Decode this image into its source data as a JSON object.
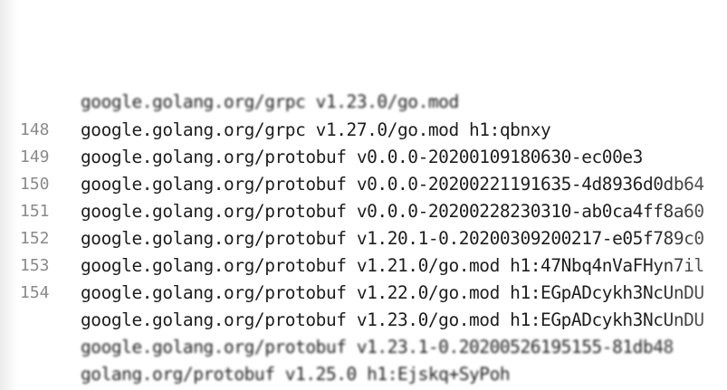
{
  "editor": {
    "lines": [
      {
        "number": "",
        "text": "",
        "blur": "heavy"
      },
      {
        "number": "",
        "text": "",
        "blur": "heavy"
      },
      {
        "number": "",
        "text": "google.golang.org/grpc v1.23.0/go.mod",
        "blur": "light"
      },
      {
        "number": "",
        "text": "google.golang.org/grpc v1.27.0/go.mod h1:qbnxy",
        "blur": "none"
      },
      {
        "number": "148",
        "text": "google.golang.org/protobuf v0.0.0-20200109180630-ec00e3",
        "blur": "none"
      },
      {
        "number": "149",
        "text": "google.golang.org/protobuf v0.0.0-20200221191635-4d8936d0db64",
        "blur": "none"
      },
      {
        "number": "150",
        "text": "google.golang.org/protobuf v0.0.0-20200228230310-ab0ca4ff8a60",
        "blur": "none"
      },
      {
        "number": "151",
        "text": "google.golang.org/protobuf v1.20.1-0.20200309200217-e05f789c0",
        "blur": "none"
      },
      {
        "number": "152",
        "text": "google.golang.org/protobuf v1.21.0/go.mod h1:47Nbq4nVaFHyn7il",
        "blur": "none"
      },
      {
        "number": "153",
        "text": "google.golang.org/protobuf v1.22.0/go.mod h1:EGpADcykh3NcUnDU",
        "blur": "none"
      },
      {
        "number": "154",
        "text": "google.golang.org/protobuf v1.23.0/go.mod h1:EGpADcykh3NcUnDU",
        "blur": "none"
      },
      {
        "number": "",
        "text": "google.golang.org/protobuf v1.23.1-0.20200526195155-81db48",
        "blur": "none"
      },
      {
        "number": "",
        "text": "golang.org/protobuf v1.25.0 h1:Ejskq+SyPoh",
        "blur": "light"
      },
      {
        "number": "",
        "text": "",
        "blur": "heavy"
      },
      {
        "number": "",
        "text": "",
        "blur": "heavy"
      }
    ]
  }
}
